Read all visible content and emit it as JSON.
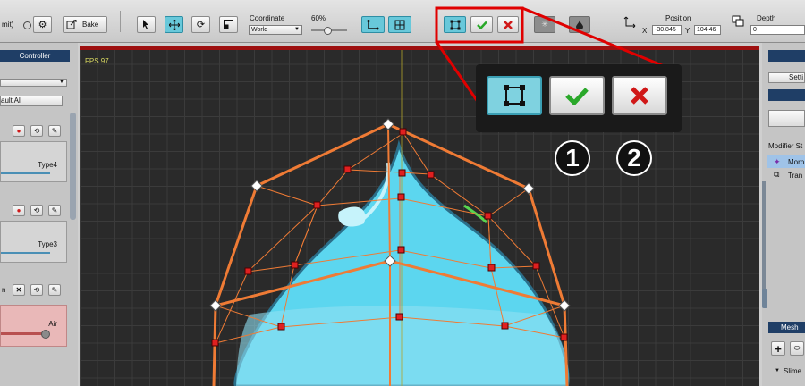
{
  "toolbar": {
    "unit_label": "mit)",
    "bake_label": "Bake",
    "coordinate_label": "Coordinate",
    "coordinate_value": "World",
    "zoom_value": "60%",
    "zoom_fraction": 0.45,
    "position_label": "Position",
    "pos_x_label": "X",
    "pos_x_value": "-30.845",
    "pos_y_label": "Y",
    "pos_y_value": "104.46",
    "depth_label": "Depth",
    "depth_value": "0"
  },
  "left_panel": {
    "header": "Controller",
    "default_all_label": "ault All",
    "type4_label": "Type4",
    "type3_label": "Type3",
    "row3_prefix": "n",
    "air_label": "Air"
  },
  "viewport": {
    "fps_text": "FPS 97"
  },
  "right_panel": {
    "settings_label": "Setti",
    "modifier_stack_label": "Modifier St",
    "modifier_1": "Morp",
    "modifier_2": "Tran",
    "mesh_header": "Mesh",
    "slime_label": "Slime"
  },
  "callout": {
    "num1": "1",
    "num2": "2"
  },
  "colors": {
    "accent_cyan": "#68c8da",
    "confirm_green": "#2aa82a",
    "cancel_red": "#d01818",
    "highlight_red": "#e00000",
    "mesh_orange": "#ef7b35",
    "panel_header": "#1f3e66"
  }
}
